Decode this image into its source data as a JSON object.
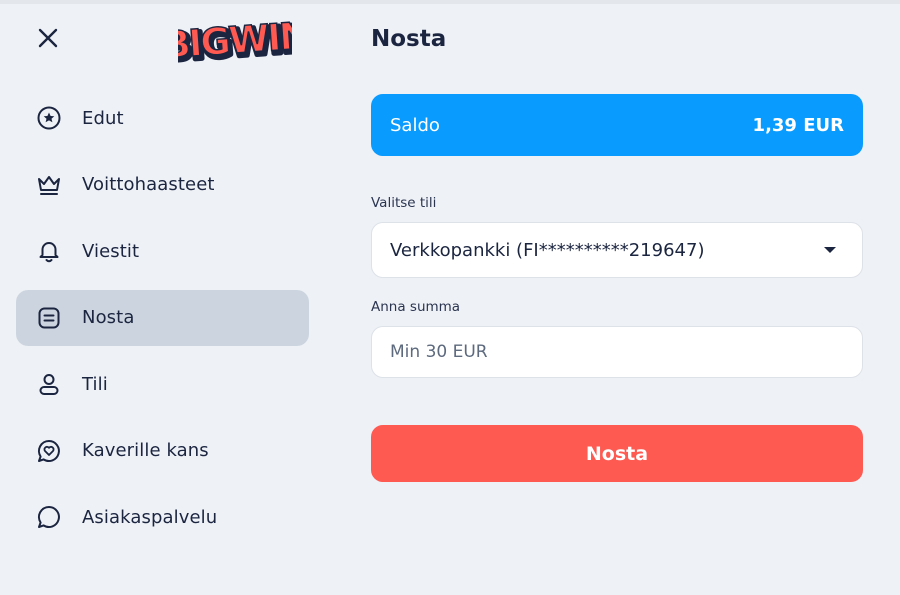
{
  "brand": {
    "logo_text": "BIGWIN"
  },
  "sidebar": {
    "items": [
      {
        "label": "Edut",
        "icon": "star-badge-icon"
      },
      {
        "label": "Voittohaasteet",
        "icon": "crown-icon"
      },
      {
        "label": "Viestit",
        "icon": "bell-icon"
      },
      {
        "label": "Nosta",
        "icon": "withdraw-icon",
        "active": true
      },
      {
        "label": "Tili",
        "icon": "user-icon"
      },
      {
        "label": "Kaverille kans",
        "icon": "heart-chat-icon"
      },
      {
        "label": "Asiakaspalvelu",
        "icon": "chat-bubble-icon"
      }
    ]
  },
  "main": {
    "title": "Nosta",
    "balance": {
      "label": "Saldo",
      "amount": "1,39 EUR"
    },
    "account_select": {
      "label": "Valitse tili",
      "value": "Verkkopankki (FI**********219647)"
    },
    "amount": {
      "label": "Anna summa",
      "placeholder": "Min 30 EUR",
      "value": ""
    },
    "submit_label": "Nosta"
  },
  "colors": {
    "background": "#eef1f6",
    "balance_card": "#0a9bff",
    "submit_button": "#ff5a52",
    "active_nav": "#ccd5df",
    "text": "#1b2540"
  }
}
